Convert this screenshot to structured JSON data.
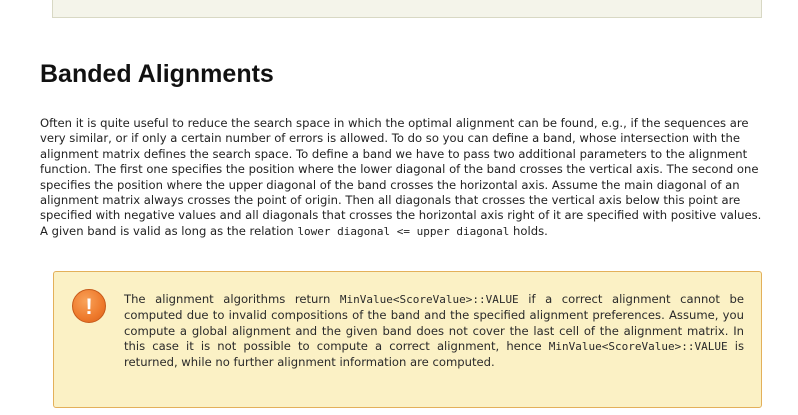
{
  "section": {
    "title": "Banded Alignments"
  },
  "paragraph": {
    "text_1": "Often it is quite useful to reduce the search space in which the optimal alignment can be found, e.g., if the sequences are very similar, or if only a certain number of errors is allowed. To do so you can define a band, whose intersection with the alignment matrix defines the search space. To define a band we have to pass two additional parameters to the alignment function. The first one specifies the position where the lower diagonal of the band crosses the vertical axis. The second one specifies the position where the upper diagonal of the band crosses the horizontal axis. Assume the main diagonal of an alignment matrix always crosses the point of origin. Then all diagonals that crosses the vertical axis below this point are specified with negative values and all diagonals that crosses the horizontal axis right of it are specified with positive values. A given band is valid as long as the relation ",
    "code_relation": "lower diagonal <= upper diagonal",
    "text_2": " holds."
  },
  "note": {
    "icon_glyph": "!",
    "text_1": "The alignment algorithms return ",
    "code_1": "MinValue<ScoreValue>::VALUE",
    "text_2": " if a correct alignment cannot be computed due to invalid compositions of the band and the specified alignment preferences. Assume, you compute a global alignment and the given band does not cover the last cell of the alignment matrix. In this case it is not possible to compute a correct alignment, hence ",
    "code_2": "MinValue<ScoreValue>::VALUE",
    "text_3": " is returned, while no further alignment information are computed."
  },
  "colors": {
    "note_background": "#fbf1c5",
    "note_border": "#e3b05a",
    "warning_icon": "#ee7a2c"
  }
}
